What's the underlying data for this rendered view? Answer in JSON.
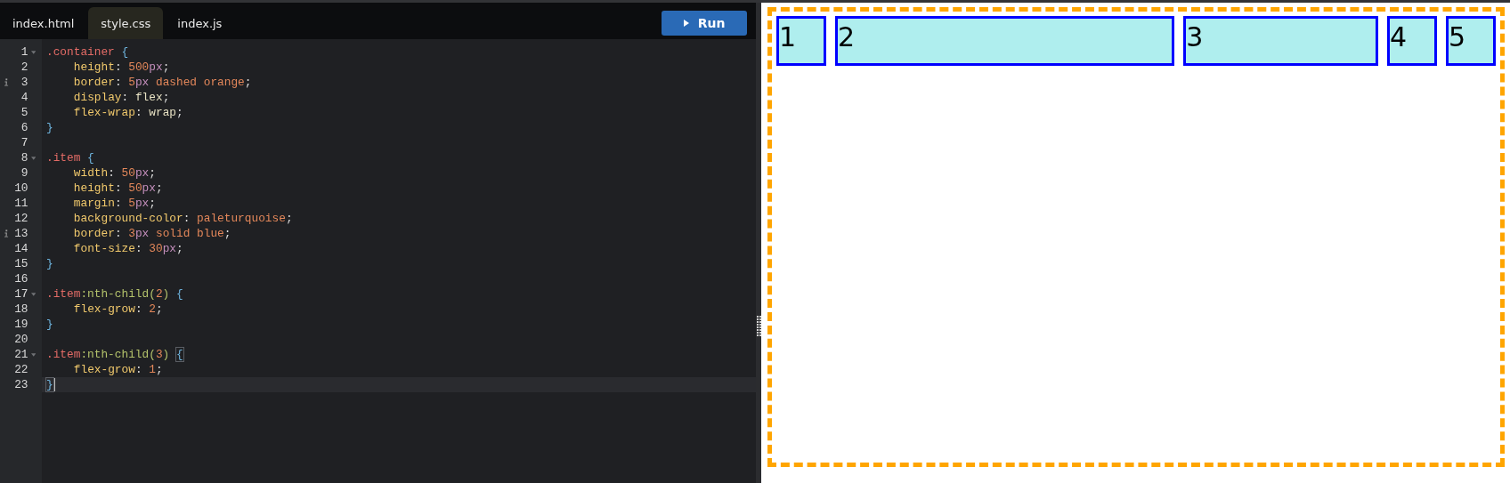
{
  "editor": {
    "tabs": [
      {
        "label": "index.html",
        "selected": false
      },
      {
        "label": "style.css",
        "selected": true
      },
      {
        "label": "index.js",
        "selected": false
      }
    ],
    "run_button": {
      "label": "Run"
    },
    "lines": [
      {
        "number": "1",
        "foldable": true,
        "info": false,
        "active": false,
        "indent": false,
        "tokens": [
          {
            "kind": "selector",
            "text": ".container"
          },
          {
            "kind": "brace",
            "text": "{"
          }
        ]
      },
      {
        "number": "2",
        "foldable": false,
        "info": false,
        "active": false,
        "indent": true,
        "tokens": [
          {
            "kind": "property",
            "text": "height"
          },
          {
            "kind": "punct",
            "text": ": "
          },
          {
            "kind": "number",
            "text": "500"
          },
          {
            "kind": "unit",
            "text": "px"
          },
          {
            "kind": "punct",
            "text": ";"
          }
        ]
      },
      {
        "number": "3",
        "foldable": false,
        "info": true,
        "active": false,
        "indent": true,
        "tokens": [
          {
            "kind": "property",
            "text": "border"
          },
          {
            "kind": "punct",
            "text": ": "
          },
          {
            "kind": "number",
            "text": "5"
          },
          {
            "kind": "unit",
            "text": "px"
          },
          {
            "kind": "value",
            "text": " dashed orange"
          },
          {
            "kind": "punct",
            "text": ";"
          }
        ]
      },
      {
        "number": "4",
        "foldable": false,
        "info": false,
        "active": false,
        "indent": true,
        "tokens": [
          {
            "kind": "property",
            "text": "display"
          },
          {
            "kind": "punct",
            "text": ": "
          },
          {
            "kind": "keyword",
            "text": "flex"
          },
          {
            "kind": "punct",
            "text": ";"
          }
        ]
      },
      {
        "number": "5",
        "foldable": false,
        "info": false,
        "active": false,
        "indent": true,
        "tokens": [
          {
            "kind": "property",
            "text": "flex-wrap"
          },
          {
            "kind": "punct",
            "text": ": "
          },
          {
            "kind": "keyword",
            "text": "wrap"
          },
          {
            "kind": "punct",
            "text": ";"
          }
        ]
      },
      {
        "number": "6",
        "foldable": false,
        "info": false,
        "active": false,
        "indent": false,
        "tokens": [
          {
            "kind": "brace",
            "text": "}"
          }
        ]
      },
      {
        "number": "7",
        "foldable": false,
        "info": false,
        "active": false,
        "indent": false
      },
      {
        "number": "8",
        "foldable": true,
        "info": false,
        "active": false,
        "indent": false,
        "tokens": [
          {
            "kind": "selector",
            "text": ".item"
          },
          {
            "kind": "brace",
            "text": "{"
          }
        ]
      },
      {
        "number": "9",
        "foldable": false,
        "info": false,
        "active": false,
        "indent": true,
        "tokens": [
          {
            "kind": "property",
            "text": "width"
          },
          {
            "kind": "punct",
            "text": ": "
          },
          {
            "kind": "number",
            "text": "50"
          },
          {
            "kind": "unit",
            "text": "px"
          },
          {
            "kind": "punct",
            "text": ";"
          }
        ]
      },
      {
        "number": "10",
        "foldable": false,
        "info": false,
        "active": false,
        "indent": true,
        "tokens": [
          {
            "kind": "property",
            "text": "height"
          },
          {
            "kind": "punct",
            "text": ": "
          },
          {
            "kind": "number",
            "text": "50"
          },
          {
            "kind": "unit",
            "text": "px"
          },
          {
            "kind": "punct",
            "text": ";"
          }
        ]
      },
      {
        "number": "11",
        "foldable": false,
        "info": false,
        "active": false,
        "indent": true,
        "tokens": [
          {
            "kind": "property",
            "text": "margin"
          },
          {
            "kind": "punct",
            "text": ": "
          },
          {
            "kind": "number",
            "text": "5"
          },
          {
            "kind": "unit",
            "text": "px"
          },
          {
            "kind": "punct",
            "text": ";"
          }
        ]
      },
      {
        "number": "12",
        "foldable": false,
        "info": false,
        "active": false,
        "indent": true,
        "tokens": [
          {
            "kind": "property",
            "text": "background-color"
          },
          {
            "kind": "punct",
            "text": ": "
          },
          {
            "kind": "value",
            "text": "paleturquoise"
          },
          {
            "kind": "punct",
            "text": ";"
          }
        ]
      },
      {
        "number": "13",
        "foldable": false,
        "info": true,
        "active": false,
        "indent": true,
        "tokens": [
          {
            "kind": "property",
            "text": "border"
          },
          {
            "kind": "punct",
            "text": ": "
          },
          {
            "kind": "number",
            "text": "3"
          },
          {
            "kind": "unit",
            "text": "px"
          },
          {
            "kind": "value",
            "text": " solid blue"
          },
          {
            "kind": "punct",
            "text": ";"
          }
        ]
      },
      {
        "number": "14",
        "foldable": false,
        "info": false,
        "active": false,
        "indent": true,
        "tokens": [
          {
            "kind": "property",
            "text": "font-size"
          },
          {
            "kind": "punct",
            "text": ": "
          },
          {
            "kind": "number",
            "text": "30"
          },
          {
            "kind": "unit",
            "text": "px"
          },
          {
            "kind": "punct",
            "text": ";"
          }
        ]
      },
      {
        "number": "15",
        "foldable": false,
        "info": false,
        "active": false,
        "indent": false,
        "tokens": [
          {
            "kind": "brace",
            "text": "}"
          }
        ]
      },
      {
        "number": "16",
        "foldable": false,
        "info": false,
        "active": false,
        "indent": false
      },
      {
        "number": "17",
        "foldable": true,
        "info": false,
        "active": false,
        "indent": false,
        "tokens": [
          {
            "kind": "selector",
            "text": ".item"
          },
          {
            "kind": "pseudo",
            "text": ":nth-child("
          },
          {
            "kind": "number",
            "text": "2"
          },
          {
            "kind": "pseudo",
            "text": ")"
          },
          {
            "kind": "brace",
            "text": "{"
          }
        ]
      },
      {
        "number": "18",
        "foldable": false,
        "info": false,
        "active": false,
        "indent": true,
        "tokens": [
          {
            "kind": "property",
            "text": "flex-grow"
          },
          {
            "kind": "punct",
            "text": ": "
          },
          {
            "kind": "number",
            "text": "2"
          },
          {
            "kind": "punct",
            "text": ";"
          }
        ]
      },
      {
        "number": "19",
        "foldable": false,
        "info": false,
        "active": false,
        "indent": false,
        "tokens": [
          {
            "kind": "brace",
            "text": "}"
          }
        ]
      },
      {
        "number": "20",
        "foldable": false,
        "info": false,
        "active": false,
        "indent": false
      },
      {
        "number": "21",
        "foldable": true,
        "info": false,
        "active": false,
        "indent": false,
        "tokens": [
          {
            "kind": "selector",
            "text": ".item"
          },
          {
            "kind": "pseudo",
            "text": ":nth-child("
          },
          {
            "kind": "number",
            "text": "3"
          },
          {
            "kind": "pseudo",
            "text": ")"
          },
          {
            "kind": "brace_match",
            "text": "{"
          }
        ]
      },
      {
        "number": "22",
        "foldable": false,
        "info": false,
        "active": false,
        "indent": true,
        "tokens": [
          {
            "kind": "property",
            "text": "flex-grow"
          },
          {
            "kind": "punct",
            "text": ": "
          },
          {
            "kind": "number",
            "text": "1"
          },
          {
            "kind": "punct",
            "text": ";"
          }
        ]
      },
      {
        "number": "23",
        "foldable": false,
        "info": false,
        "active": true,
        "indent": false,
        "tokens": [
          {
            "kind": "brace_match",
            "text": "}"
          }
        ]
      }
    ]
  },
  "preview": {
    "items": [
      {
        "label": "1"
      },
      {
        "label": "2"
      },
      {
        "label": "3"
      },
      {
        "label": "4"
      },
      {
        "label": "5"
      }
    ]
  }
}
